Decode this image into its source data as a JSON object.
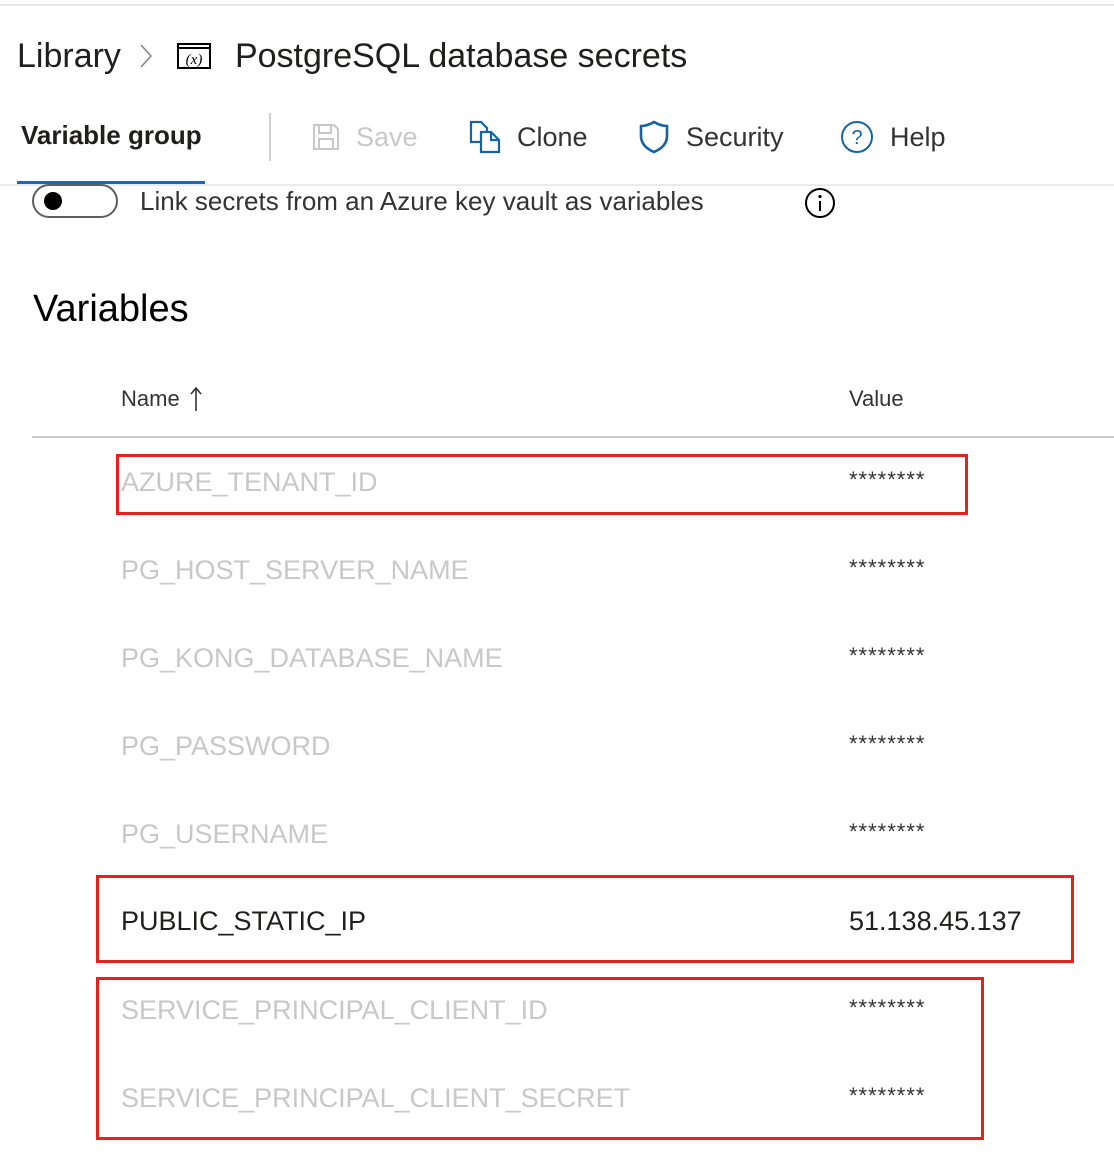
{
  "breadcrumb": {
    "root": "Library",
    "separator_icon": "chevron-right-icon",
    "item_icon": "variable-group-icon",
    "title": "PostgreSQL database secrets"
  },
  "toolbar": {
    "active_tab": "Variable group",
    "buttons": [
      {
        "label": "Save",
        "icon": "save-icon",
        "enabled": false
      },
      {
        "label": "Clone",
        "icon": "clone-icon",
        "enabled": true
      },
      {
        "label": "Security",
        "icon": "shield-icon",
        "enabled": true
      },
      {
        "label": "Help",
        "icon": "help-icon",
        "enabled": true
      }
    ]
  },
  "key_vault": {
    "label": "Link secrets from an Azure key vault as variables",
    "toggle_on": false,
    "info_icon": "info-icon"
  },
  "variables": {
    "title": "Variables",
    "columns": {
      "name": "Name",
      "value": "Value",
      "sort": "ascending"
    },
    "rows": [
      {
        "name": "AZURE_TENANT_ID",
        "value": "********",
        "secret": true,
        "highlighted": true
      },
      {
        "name": "PG_HOST_SERVER_NAME",
        "value": "********",
        "secret": true,
        "highlighted": false
      },
      {
        "name": "PG_KONG_DATABASE_NAME",
        "value": "********",
        "secret": true,
        "highlighted": false
      },
      {
        "name": "PG_PASSWORD",
        "value": "********",
        "secret": true,
        "highlighted": false
      },
      {
        "name": "PG_USERNAME",
        "value": "********",
        "secret": true,
        "highlighted": false
      },
      {
        "name": "PUBLIC_STATIC_IP",
        "value": "51.138.45.137",
        "secret": false,
        "highlighted": true
      },
      {
        "name": "SERVICE_PRINCIPAL_CLIENT_ID",
        "value": "********",
        "secret": true,
        "highlighted": true
      },
      {
        "name": "SERVICE_PRINCIPAL_CLIENT_SECRET",
        "value": "********",
        "secret": true,
        "highlighted": true
      }
    ]
  },
  "colors": {
    "accent": "#0a6fcc",
    "icon_blue": "#1464a5",
    "highlight_box": "#e3231b",
    "muted_text": "#c8c8c8"
  }
}
